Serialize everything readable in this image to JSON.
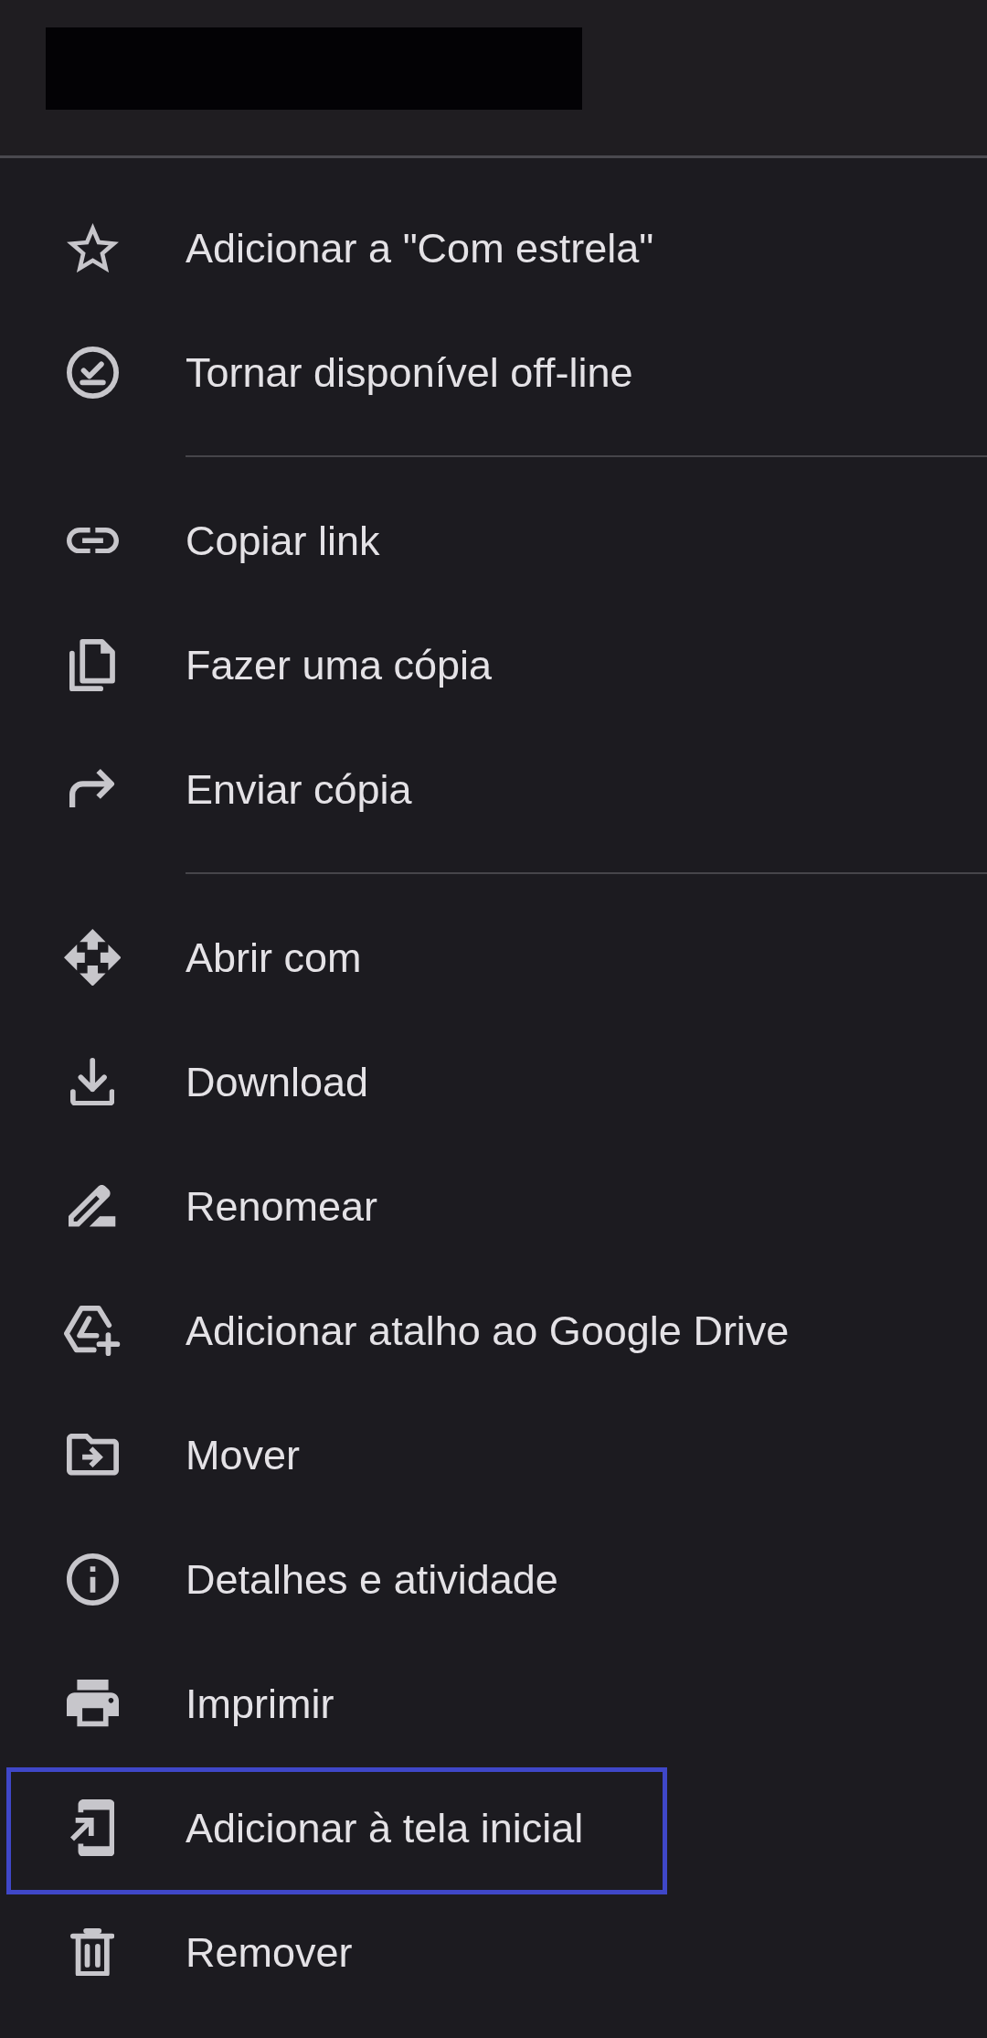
{
  "menu": {
    "sections": [
      {
        "items": [
          {
            "label": "Adicionar a \"Com estrela\"",
            "highlighted": false
          },
          {
            "label": "Tornar disponível off-line",
            "highlighted": false
          }
        ]
      },
      {
        "items": [
          {
            "label": "Copiar link",
            "highlighted": false
          },
          {
            "label": "Fazer uma cópia",
            "highlighted": false
          },
          {
            "label": "Enviar cópia",
            "highlighted": false
          }
        ]
      },
      {
        "items": [
          {
            "label": "Abrir com",
            "highlighted": false
          },
          {
            "label": "Download",
            "highlighted": false
          },
          {
            "label": "Renomear",
            "highlighted": false
          },
          {
            "label": "Adicionar atalho ao Google Drive",
            "highlighted": false
          },
          {
            "label": "Mover",
            "highlighted": false
          },
          {
            "label": "Detalhes e atividade",
            "highlighted": false
          },
          {
            "label": "Imprimir",
            "highlighted": false
          },
          {
            "label": "Adicionar à tela inicial",
            "highlighted": true
          },
          {
            "label": "Remover",
            "highlighted": false
          }
        ]
      }
    ]
  }
}
